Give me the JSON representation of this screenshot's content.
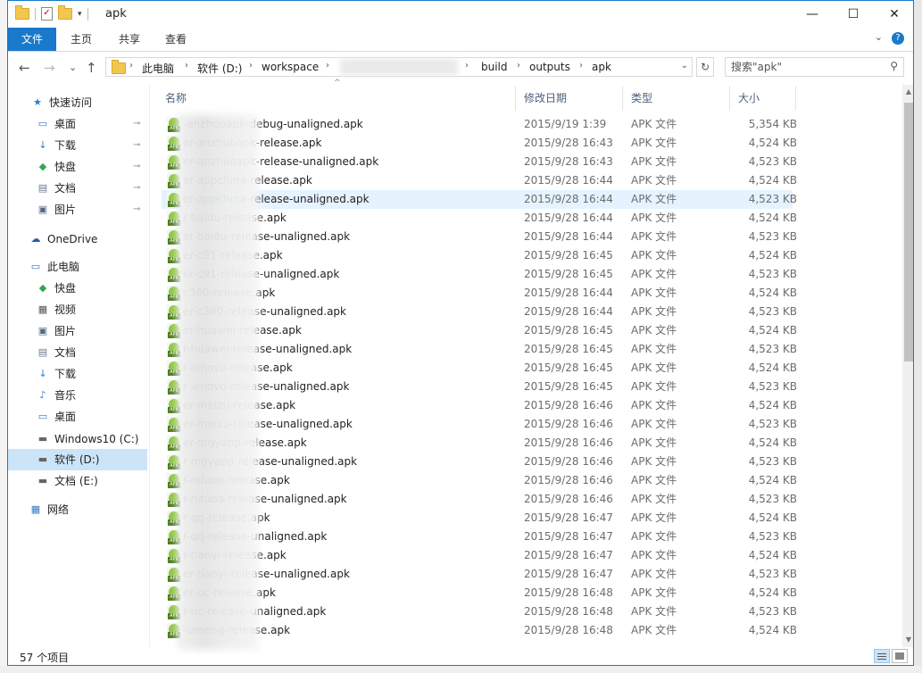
{
  "window": {
    "title": "apk",
    "minimize": "—",
    "maximize": "☐",
    "close": "✕"
  },
  "ribbon": {
    "tabs": [
      "文件",
      "主页",
      "共享",
      "查看"
    ],
    "help": "?"
  },
  "nav": {
    "back": "←",
    "forward": "→",
    "recent": "⌄",
    "up": "↑",
    "breadcrumb": [
      "此电脑",
      "软件 (D:)",
      "workspace",
      "",
      "build",
      "outputs",
      "apk"
    ],
    "refresh": "↻",
    "search_placeholder": "搜索\"apk\""
  },
  "sidebar": {
    "items": [
      {
        "label": "快速访问",
        "icon": "star-icon",
        "pinned": false
      },
      {
        "label": "桌面",
        "icon": "desktop-icon",
        "pinned": true
      },
      {
        "label": "下载",
        "icon": "download-icon",
        "pinned": true
      },
      {
        "label": "快盘",
        "icon": "kuaipan-icon",
        "pinned": true
      },
      {
        "label": "文档",
        "icon": "documents-icon",
        "pinned": true
      },
      {
        "label": "图片",
        "icon": "pictures-icon",
        "pinned": true
      },
      {
        "label": "OneDrive",
        "icon": "onedrive-icon",
        "pinned": false
      },
      {
        "label": "此电脑",
        "icon": "computer-icon",
        "pinned": false
      },
      {
        "label": "快盘",
        "icon": "kuaipan-icon",
        "pinned": false
      },
      {
        "label": "视频",
        "icon": "video-icon",
        "pinned": false
      },
      {
        "label": "图片",
        "icon": "pictures-icon",
        "pinned": false
      },
      {
        "label": "文档",
        "icon": "documents-icon",
        "pinned": false
      },
      {
        "label": "下载",
        "icon": "download-icon",
        "pinned": false
      },
      {
        "label": "音乐",
        "icon": "music-icon",
        "pinned": false
      },
      {
        "label": "桌面",
        "icon": "desktop-icon",
        "pinned": false
      },
      {
        "label": "Windows10 (C:)",
        "icon": "drive-icon",
        "pinned": false
      },
      {
        "label": "软件 (D:)",
        "icon": "drive-icon",
        "pinned": false,
        "selected": true
      },
      {
        "label": "文档 (E:)",
        "icon": "drive-icon",
        "pinned": false
      },
      {
        "label": "网络",
        "icon": "network-icon",
        "pinned": false
      }
    ]
  },
  "columns": {
    "name": "名称",
    "date": "修改日期",
    "type": "类型",
    "size": "大小"
  },
  "files": [
    {
      "name": "-anzhuoapk-debug-unaligned.apk",
      "date": "2015/9/19 1:39",
      "type": "APK 文件",
      "size": "5,354 KB"
    },
    {
      "name": "er-anzhuoapk-release.apk",
      "date": "2015/9/28 16:43",
      "type": "APK 文件",
      "size": "4,524 KB"
    },
    {
      "name": "er-anzhuoapk-release-unaligned.apk",
      "date": "2015/9/28 16:43",
      "type": "APK 文件",
      "size": "4,523 KB"
    },
    {
      "name": "er-appchina-release.apk",
      "date": "2015/9/28 16:44",
      "type": "APK 文件",
      "size": "4,524 KB"
    },
    {
      "name": "er-appchina-release-unaligned.apk",
      "date": "2015/9/28 16:44",
      "type": "APK 文件",
      "size": "4,523 KB",
      "selected": true
    },
    {
      "name": "r-baidu-release.apk",
      "date": "2015/9/28 16:44",
      "type": "APK 文件",
      "size": "4,524 KB"
    },
    {
      "name": "er-baidu-release-unaligned.apk",
      "date": "2015/9/28 16:44",
      "type": "APK 文件",
      "size": "4,523 KB"
    },
    {
      "name": "er-c91-release.apk",
      "date": "2015/9/28 16:45",
      "type": "APK 文件",
      "size": "4,524 KB"
    },
    {
      "name": "er-c91-release-unaligned.apk",
      "date": "2015/9/28 16:45",
      "type": "APK 文件",
      "size": "4,523 KB"
    },
    {
      "name": "c360-release.apk",
      "date": "2015/9/28 16:44",
      "type": "APK 文件",
      "size": "4,524 KB"
    },
    {
      "name": "er-c360-release-unaligned.apk",
      "date": "2015/9/28 16:44",
      "type": "APK 文件",
      "size": "4,523 KB"
    },
    {
      "name": "er-huawei-release.apk",
      "date": "2015/9/28 16:45",
      "type": "APK 文件",
      "size": "4,524 KB"
    },
    {
      "name": "r-huawei-release-unaligned.apk",
      "date": "2015/9/28 16:45",
      "type": "APK 文件",
      "size": "4,523 KB"
    },
    {
      "name": "r-lenovo-release.apk",
      "date": "2015/9/28 16:45",
      "type": "APK 文件",
      "size": "4,524 KB"
    },
    {
      "name": "r-lenovo-release-unaligned.apk",
      "date": "2015/9/28 16:45",
      "type": "APK 文件",
      "size": "4,523 KB"
    },
    {
      "name": "er-meizu-release.apk",
      "date": "2015/9/28 16:46",
      "type": "APK 文件",
      "size": "4,524 KB"
    },
    {
      "name": "er-meizu-release-unaligned.apk",
      "date": "2015/9/28 16:46",
      "type": "APK 文件",
      "size": "4,523 KB"
    },
    {
      "name": "er-mgyapp-release.apk",
      "date": "2015/9/28 16:46",
      "type": "APK 文件",
      "size": "4,524 KB"
    },
    {
      "name": "r-mgyapp-release-unaligned.apk",
      "date": "2015/9/28 16:46",
      "type": "APK 文件",
      "size": "4,523 KB"
    },
    {
      "name": "r-nduoa-release.apk",
      "date": "2015/9/28 16:46",
      "type": "APK 文件",
      "size": "4,524 KB"
    },
    {
      "name": "r-nduoa-release-unaligned.apk",
      "date": "2015/9/28 16:46",
      "type": "APK 文件",
      "size": "4,523 KB"
    },
    {
      "name": "r-qq-release.apk",
      "date": "2015/9/28 16:47",
      "type": "APK 文件",
      "size": "4,524 KB"
    },
    {
      "name": "r-qq-release-unaligned.apk",
      "date": "2015/9/28 16:47",
      "type": "APK 文件",
      "size": "4,523 KB"
    },
    {
      "name": "r-tianyi-release.apk",
      "date": "2015/9/28 16:47",
      "type": "APK 文件",
      "size": "4,524 KB"
    },
    {
      "name": "er-tianyi-release-unaligned.apk",
      "date": "2015/9/28 16:47",
      "type": "APK 文件",
      "size": "4,523 KB"
    },
    {
      "name": "er-uc-release.apk",
      "date": "2015/9/28 16:48",
      "type": "APK 文件",
      "size": "4,524 KB"
    },
    {
      "name": "r-uc-release-unaligned.apk",
      "date": "2015/9/28 16:48",
      "type": "APK 文件",
      "size": "4,523 KB"
    },
    {
      "name": "-umeng-release.apk",
      "date": "2015/9/28 16:48",
      "type": "APK 文件",
      "size": "4,524 KB"
    }
  ],
  "status": {
    "count": "57 个项目"
  },
  "colors": {
    "accent": "#1979ca",
    "selection": "#cce4f7",
    "hover_row": "#e5f3ff"
  }
}
